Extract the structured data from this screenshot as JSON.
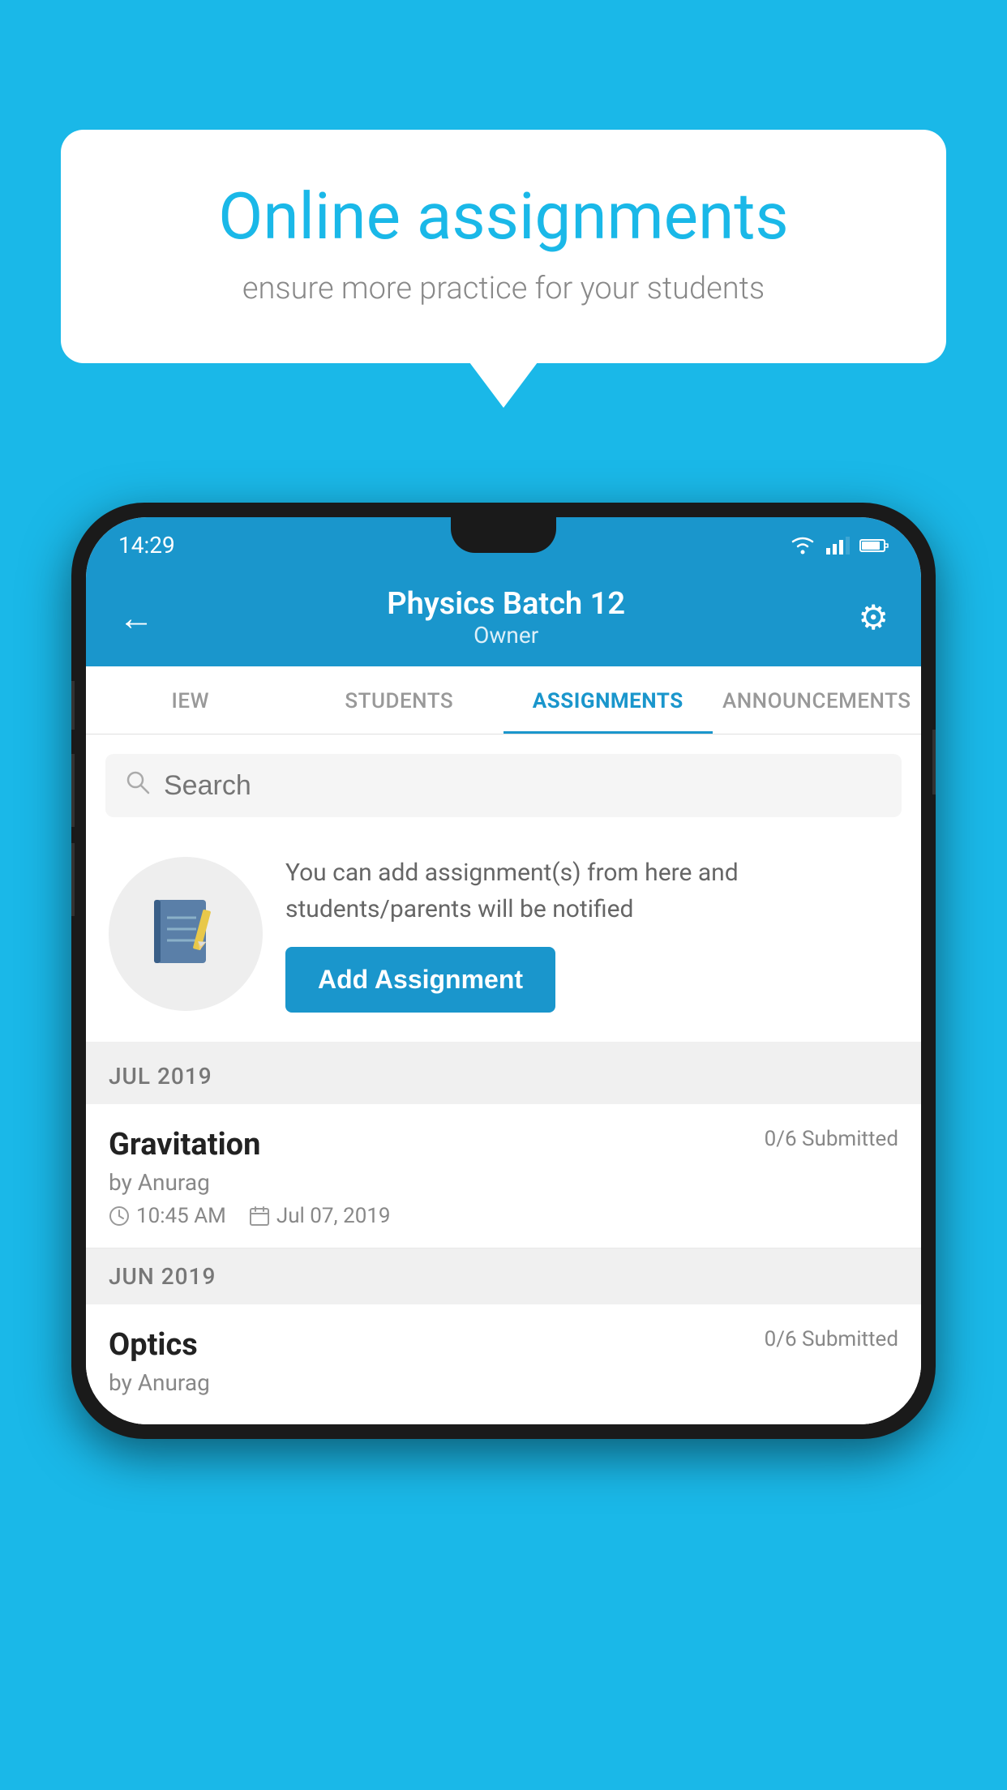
{
  "background_color": "#1ab8e8",
  "speech_bubble": {
    "heading": "Online assignments",
    "subtext": "ensure more practice for your students"
  },
  "status_bar": {
    "time": "14:29"
  },
  "app_header": {
    "back_label": "←",
    "title": "Physics Batch 12",
    "owner": "Owner",
    "gear_symbol": "⚙"
  },
  "tabs": [
    {
      "label": "IEW",
      "active": false
    },
    {
      "label": "STUDENTS",
      "active": false
    },
    {
      "label": "ASSIGNMENTS",
      "active": true
    },
    {
      "label": "ANNOUNCEMENTS",
      "active": false
    }
  ],
  "search": {
    "placeholder": "Search"
  },
  "promo": {
    "text": "You can add assignment(s) from here and students/parents will be notified",
    "button_label": "Add Assignment"
  },
  "sections": [
    {
      "month": "JUL 2019",
      "assignments": [
        {
          "name": "Gravitation",
          "submitted": "0/6 Submitted",
          "by": "by Anurag",
          "time": "10:45 AM",
          "date": "Jul 07, 2019"
        }
      ]
    },
    {
      "month": "JUN 2019",
      "assignments": [
        {
          "name": "Optics",
          "submitted": "0/6 Submitted",
          "by": "by Anurag",
          "time": "",
          "date": ""
        }
      ]
    }
  ]
}
